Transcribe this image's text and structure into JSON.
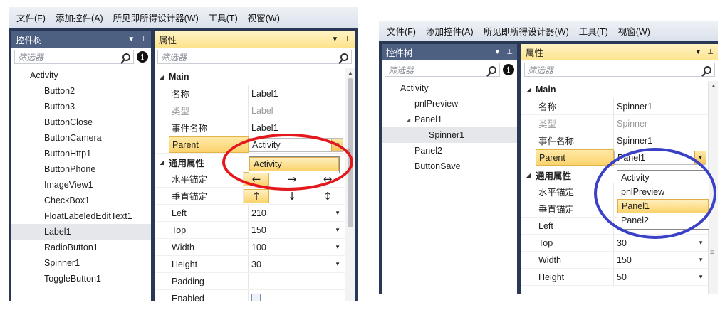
{
  "colors": {
    "frame": "#293955",
    "tree_header": "#4d6082",
    "highlight": "#fbd36c",
    "red_ellipse": "#e3171c",
    "blue_ellipse": "#3b41c6"
  },
  "left": {
    "menu": [
      "文件(F)",
      "添加控件(A)",
      "所见即所得设计器(W)",
      "工具(T)",
      "视窗(W)"
    ],
    "tree_panel": {
      "title": "控件树",
      "filter_placeholder": "筛选器"
    },
    "props_panel": {
      "title": "属性",
      "filter_placeholder": "筛选器"
    },
    "tree": [
      {
        "label": "Activity",
        "level": 0
      },
      {
        "label": "Button2",
        "level": 1
      },
      {
        "label": "Button3",
        "level": 1
      },
      {
        "label": "ButtonClose",
        "level": 1
      },
      {
        "label": "ButtonCamera",
        "level": 1
      },
      {
        "label": "ButtonHttp1",
        "level": 1
      },
      {
        "label": "ButtonPhone",
        "level": 1
      },
      {
        "label": "ImageView1",
        "level": 1
      },
      {
        "label": "CheckBox1",
        "level": 1
      },
      {
        "label": "FloatLabeledEditText1",
        "level": 1
      },
      {
        "label": "Label1",
        "level": 1,
        "selected": true
      },
      {
        "label": "RadioButton1",
        "level": 1
      },
      {
        "label": "Spinner1",
        "level": 1
      },
      {
        "label": "ToggleButton1",
        "level": 1
      }
    ],
    "main_category": "Main",
    "common_category": "通用属性",
    "main_props": [
      {
        "name": "名称",
        "value": "Label1"
      },
      {
        "name": "类型",
        "value": "Label",
        "gray": true
      },
      {
        "name": "事件名称",
        "value": "Label1"
      },
      {
        "name": "Parent",
        "value": "Activity",
        "highlight": true,
        "combo": true
      }
    ],
    "anchor_props": [
      {
        "name": "水平锚定",
        "arrows": [
          "←",
          "→",
          "↔"
        ],
        "active": 0
      },
      {
        "name": "垂直锚定",
        "arrows": [
          "↑",
          "↓",
          "↕"
        ],
        "active": 0
      }
    ],
    "common_props": [
      {
        "name": "Left",
        "value": "210",
        "caret": true
      },
      {
        "name": "Top",
        "value": "150",
        "caret": true
      },
      {
        "name": "Width",
        "value": "100",
        "caret": true
      },
      {
        "name": "Height",
        "value": "30",
        "caret": true
      },
      {
        "name": "Padding",
        "value": ""
      },
      {
        "name": "Enabled",
        "value": "",
        "checkbox": true
      }
    ],
    "dropdown": [
      {
        "label": "Activity",
        "active": true
      }
    ]
  },
  "right": {
    "menu": [
      "文件(F)",
      "添加控件(A)",
      "所见即所得设计器(W)",
      "工具(T)",
      "视窗(W)"
    ],
    "tree_panel": {
      "title": "控件树",
      "filter_placeholder": "筛选器"
    },
    "props_panel": {
      "title": "属性",
      "filter_placeholder": "筛选器"
    },
    "tree": [
      {
        "label": "Activity",
        "level": 0
      },
      {
        "label": "pnlPreview",
        "level": 1
      },
      {
        "label": "Panel1",
        "level": 1,
        "expanded": true
      },
      {
        "label": "Spinner1",
        "level": 2,
        "selected": true
      },
      {
        "label": "Panel2",
        "level": 1
      },
      {
        "label": "ButtonSave",
        "level": 1
      }
    ],
    "main_category": "Main",
    "common_category": "通用属性",
    "main_props": [
      {
        "name": "名称",
        "value": "Spinner1"
      },
      {
        "name": "类型",
        "value": "Spinner",
        "gray": true
      },
      {
        "name": "事件名称",
        "value": "Spinner1"
      },
      {
        "name": "Parent",
        "value": "Panel1",
        "highlight": true,
        "combo": true
      }
    ],
    "anchor_props": [
      {
        "name": "水平锚定",
        "arrows": [],
        "active": -1
      },
      {
        "name": "垂直锚定",
        "arrows": [],
        "active": -1
      }
    ],
    "common_props": [
      {
        "name": "Left",
        "value": "",
        "caret": false
      },
      {
        "name": "Top",
        "value": "30",
        "caret": true
      },
      {
        "name": "Width",
        "value": "150",
        "caret": true
      },
      {
        "name": "Height",
        "value": "50",
        "caret": true
      }
    ],
    "dropdown": [
      {
        "label": "Activity"
      },
      {
        "label": "pnlPreview"
      },
      {
        "label": "Panel1",
        "active": true
      },
      {
        "label": "Panel2"
      }
    ]
  }
}
